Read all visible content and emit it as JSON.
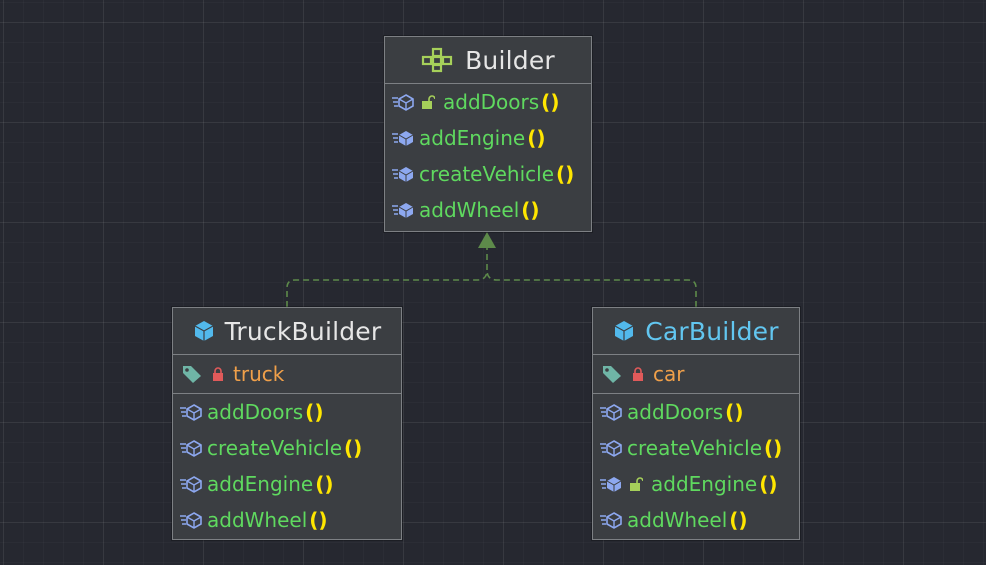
{
  "diagram": {
    "builder": {
      "title": "Builder",
      "methods": [
        {
          "name": "addDoors",
          "parens": "()"
        },
        {
          "name": "addEngine",
          "parens": "()"
        },
        {
          "name": "createVehicle",
          "parens": "()"
        },
        {
          "name": "addWheel",
          "parens": "()"
        }
      ]
    },
    "truck_builder": {
      "title": "TruckBuilder",
      "field": "truck",
      "methods": [
        {
          "name": "addDoors",
          "parens": "()"
        },
        {
          "name": "createVehicle",
          "parens": "()"
        },
        {
          "name": "addEngine",
          "parens": "()"
        },
        {
          "name": "addWheel",
          "parens": "()"
        }
      ]
    },
    "car_builder": {
      "title": "CarBuilder",
      "field": "car",
      "methods": [
        {
          "name": "addDoors",
          "parens": "()"
        },
        {
          "name": "createVehicle",
          "parens": "()"
        },
        {
          "name": "addEngine",
          "parens": "()"
        },
        {
          "name": "addWheel",
          "parens": "()"
        }
      ]
    },
    "icons": {
      "interface": "interface-icon",
      "class": "class-icon",
      "method": "method-icon",
      "field": "field-tag-icon",
      "lock_open": "unlocked-icon",
      "lock_closed": "private-lock-icon"
    },
    "colors": {
      "background": "#262830",
      "box": "#3b3e42",
      "method_name": "#5fd95f",
      "parens": "#ffe600",
      "field_name": "#f0a04a",
      "cyan_title": "#62c6f0",
      "arrow": "#5d8a4a"
    }
  }
}
